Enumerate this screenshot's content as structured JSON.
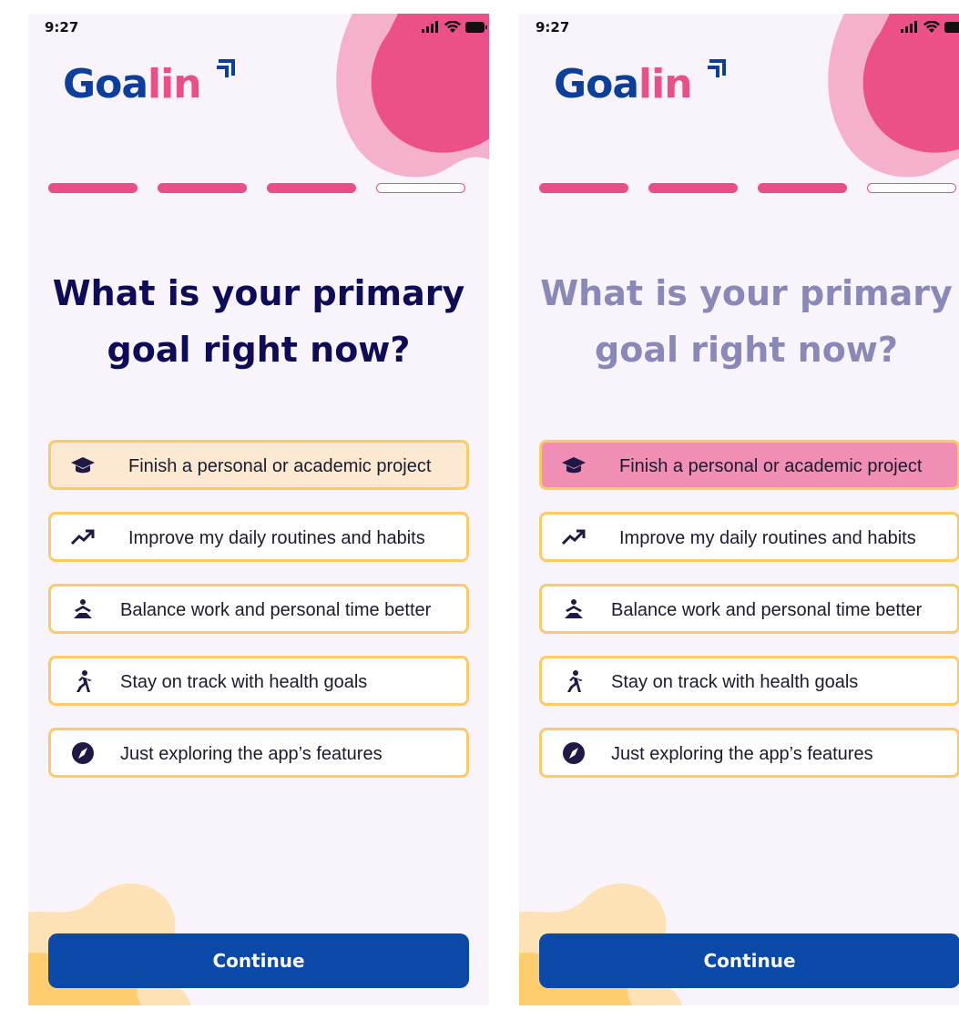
{
  "status_bar": {
    "time": "9:27"
  },
  "brand": {
    "part1": "Goa",
    "part2": "lin",
    "colors": {
      "blue": "#0c3f9b",
      "pink": "#ea4f8a"
    }
  },
  "progress": {
    "total_steps": 4,
    "completed_steps": 3
  },
  "question": {
    "line1": "What is your primary",
    "line2": "goal right now?"
  },
  "options": [
    {
      "label": "Finish a personal or academic project",
      "icon": "graduation-cap-icon"
    },
    {
      "label": "Improve my daily routines and habits",
      "icon": "trending-up-icon"
    },
    {
      "label": "Balance work and personal time better",
      "icon": "meditation-icon"
    },
    {
      "label": "Stay on track with health goals",
      "icon": "running-icon"
    },
    {
      "label": "Just exploring the app’s features",
      "icon": "compass-icon"
    }
  ],
  "screens": [
    {
      "state": "default",
      "question_color": "#0e0b57",
      "focused_option": 0,
      "selected_option": null
    },
    {
      "state": "selected",
      "question_color": "#8a88b8",
      "focused_option": null,
      "selected_option": 0
    }
  ],
  "continue_button": {
    "label": "Continue",
    "color": "#0a49a8"
  }
}
